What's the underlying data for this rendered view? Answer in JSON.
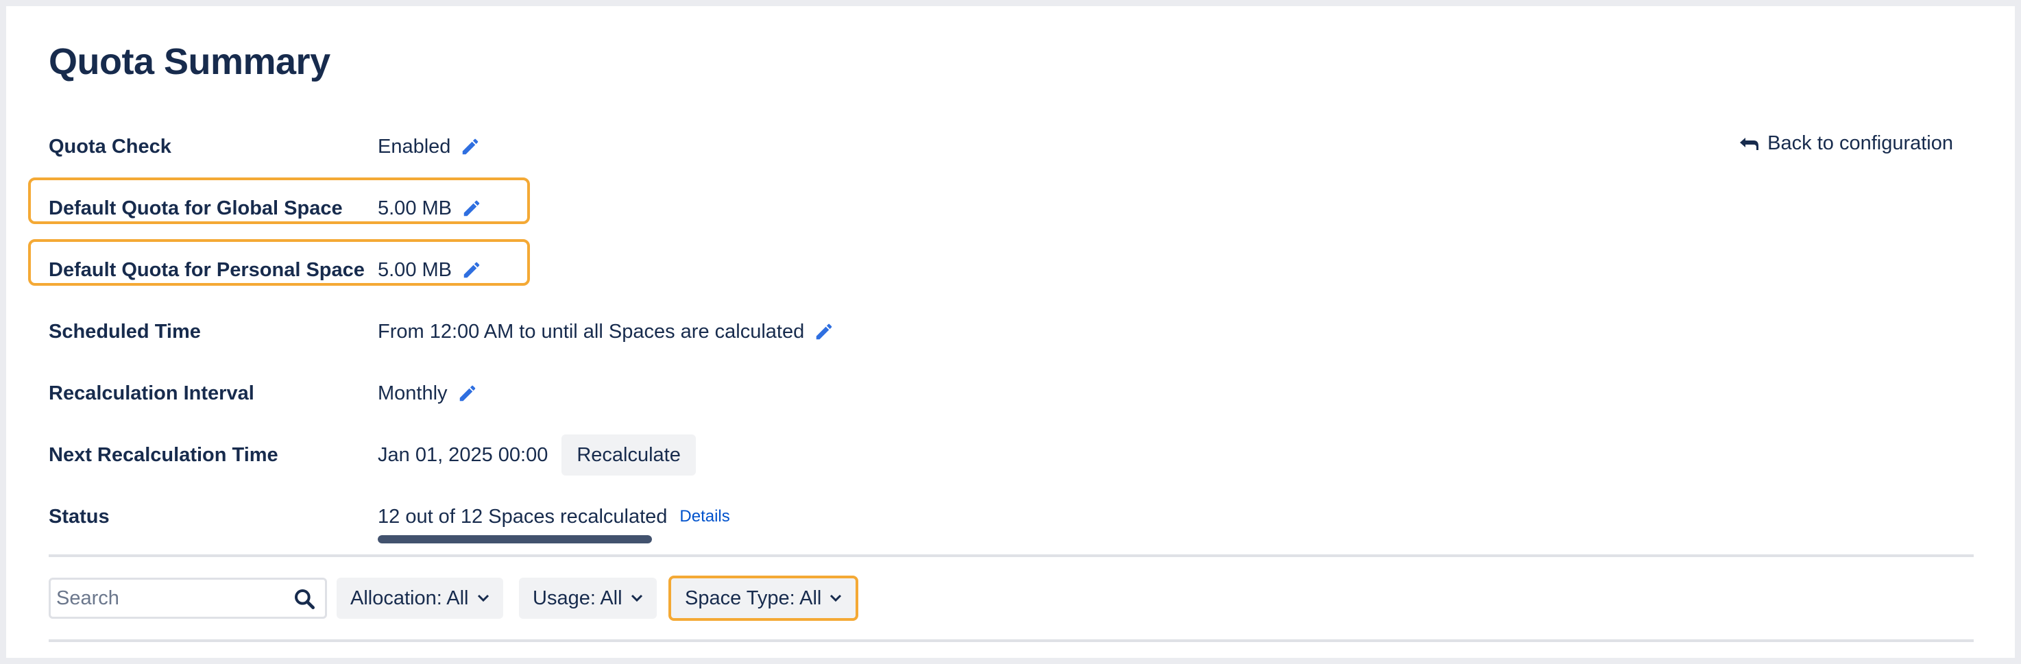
{
  "page": {
    "title": "Quota Summary"
  },
  "back_link": {
    "label": "Back to configuration"
  },
  "settings": [
    {
      "label": "Quota Check",
      "value": "Enabled"
    },
    {
      "label": "Default Quota for Global Space",
      "value": "5.00 MB"
    },
    {
      "label": "Default Quota for Personal Space",
      "value": "5.00 MB"
    },
    {
      "label": "Scheduled Time",
      "value": "From 12:00 AM to until all Spaces are calculated"
    },
    {
      "label": "Recalculation Interval",
      "value": "Monthly"
    },
    {
      "label": "Next Recalculation Time",
      "value": "Jan 01, 2025 00:00",
      "button": "Recalculate"
    },
    {
      "label": "Status",
      "value": "12 out of 12 Spaces recalculated",
      "link": "Details",
      "progress": 1.0
    }
  ],
  "filters": {
    "search_placeholder": "Search",
    "allocation": "Allocation: All",
    "usage": "Usage: All",
    "space_type": "Space Type: All"
  },
  "colors": {
    "accent": "#2f6fe0",
    "highlight": "#f4a935",
    "progress": "#42526e",
    "link": "#0052cc"
  },
  "icons": [
    "pencil-icon",
    "back-arrow-icon",
    "search-icon",
    "chevron-down-icon"
  ]
}
